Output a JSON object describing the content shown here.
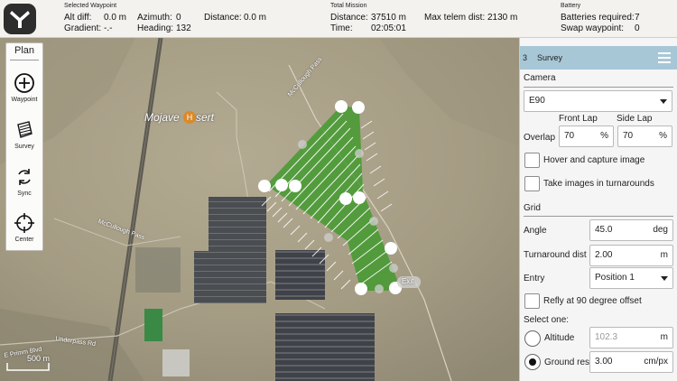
{
  "top": {
    "waypoint": {
      "title": "Selected Waypoint",
      "alt_diff_label": "Alt diff:",
      "alt_diff": "0.0 m",
      "gradient_label": "Gradient:",
      "gradient": "-.-",
      "azimuth_label": "Azimuth:",
      "azimuth": "0",
      "heading_label": "Heading:",
      "heading": "132",
      "distance_label": "Distance:",
      "distance": "0.0 m"
    },
    "mission": {
      "title": "Total Mission",
      "distance_label": "Distance:",
      "distance": "37510 m",
      "time_label": "Time:",
      "time": "02:05:01",
      "max_telem_label": "Max telem dist:",
      "max_telem": "2130 m"
    },
    "battery": {
      "title": "Battery",
      "required_label": "Batteries required:",
      "required": "7",
      "swap_label": "Swap waypoint:",
      "swap": "0"
    }
  },
  "plan": {
    "title": "Plan",
    "tools": [
      {
        "label": "Waypoint",
        "icon": "plus-circle-icon"
      },
      {
        "label": "Survey",
        "icon": "survey-icon"
      },
      {
        "label": "Sync",
        "icon": "sync-icon"
      },
      {
        "label": "Center",
        "icon": "crosshair-icon"
      }
    ]
  },
  "map": {
    "place_label": "Mojave",
    "place_label_tail": "sert",
    "home_marker": "H",
    "road_1": "McCullough Pass",
    "road_2": "McCullough Pass",
    "road_3": "Underpass Rd",
    "road_4": "E Primm Blvd",
    "scale": "500 m",
    "exit_label": "Exit",
    "colors": {
      "survey_fill": "#3f9a2c",
      "survey_lines": "#ffffff"
    }
  },
  "panel": {
    "index": "3",
    "title": "Survey",
    "camera_section": "Camera",
    "camera_value": "E90",
    "front_lap_label": "Front Lap",
    "side_lap_label": "Side Lap",
    "overlap_label": "Overlap",
    "front_lap": "70",
    "side_lap": "70",
    "percent": "%",
    "hover_capture": "Hover and capture image",
    "turnaround_images": "Take images in turnarounds",
    "grid_section": "Grid",
    "angle_label": "Angle",
    "angle": "45.0",
    "angle_unit": "deg",
    "turnaround_label": "Turnaround dist",
    "turnaround": "2.00",
    "turnaround_unit": "m",
    "entry_label": "Entry",
    "entry": "Position 1",
    "refly": "Refly at 90 degree offset",
    "select_one": "Select one:",
    "altitude_label": "Altitude",
    "altitude": "102.3",
    "altitude_unit": "m",
    "ground_res_label": "Ground res",
    "ground_res": "3.00",
    "ground_res_unit": "cm/px",
    "header_color": "#a8c7d6"
  }
}
